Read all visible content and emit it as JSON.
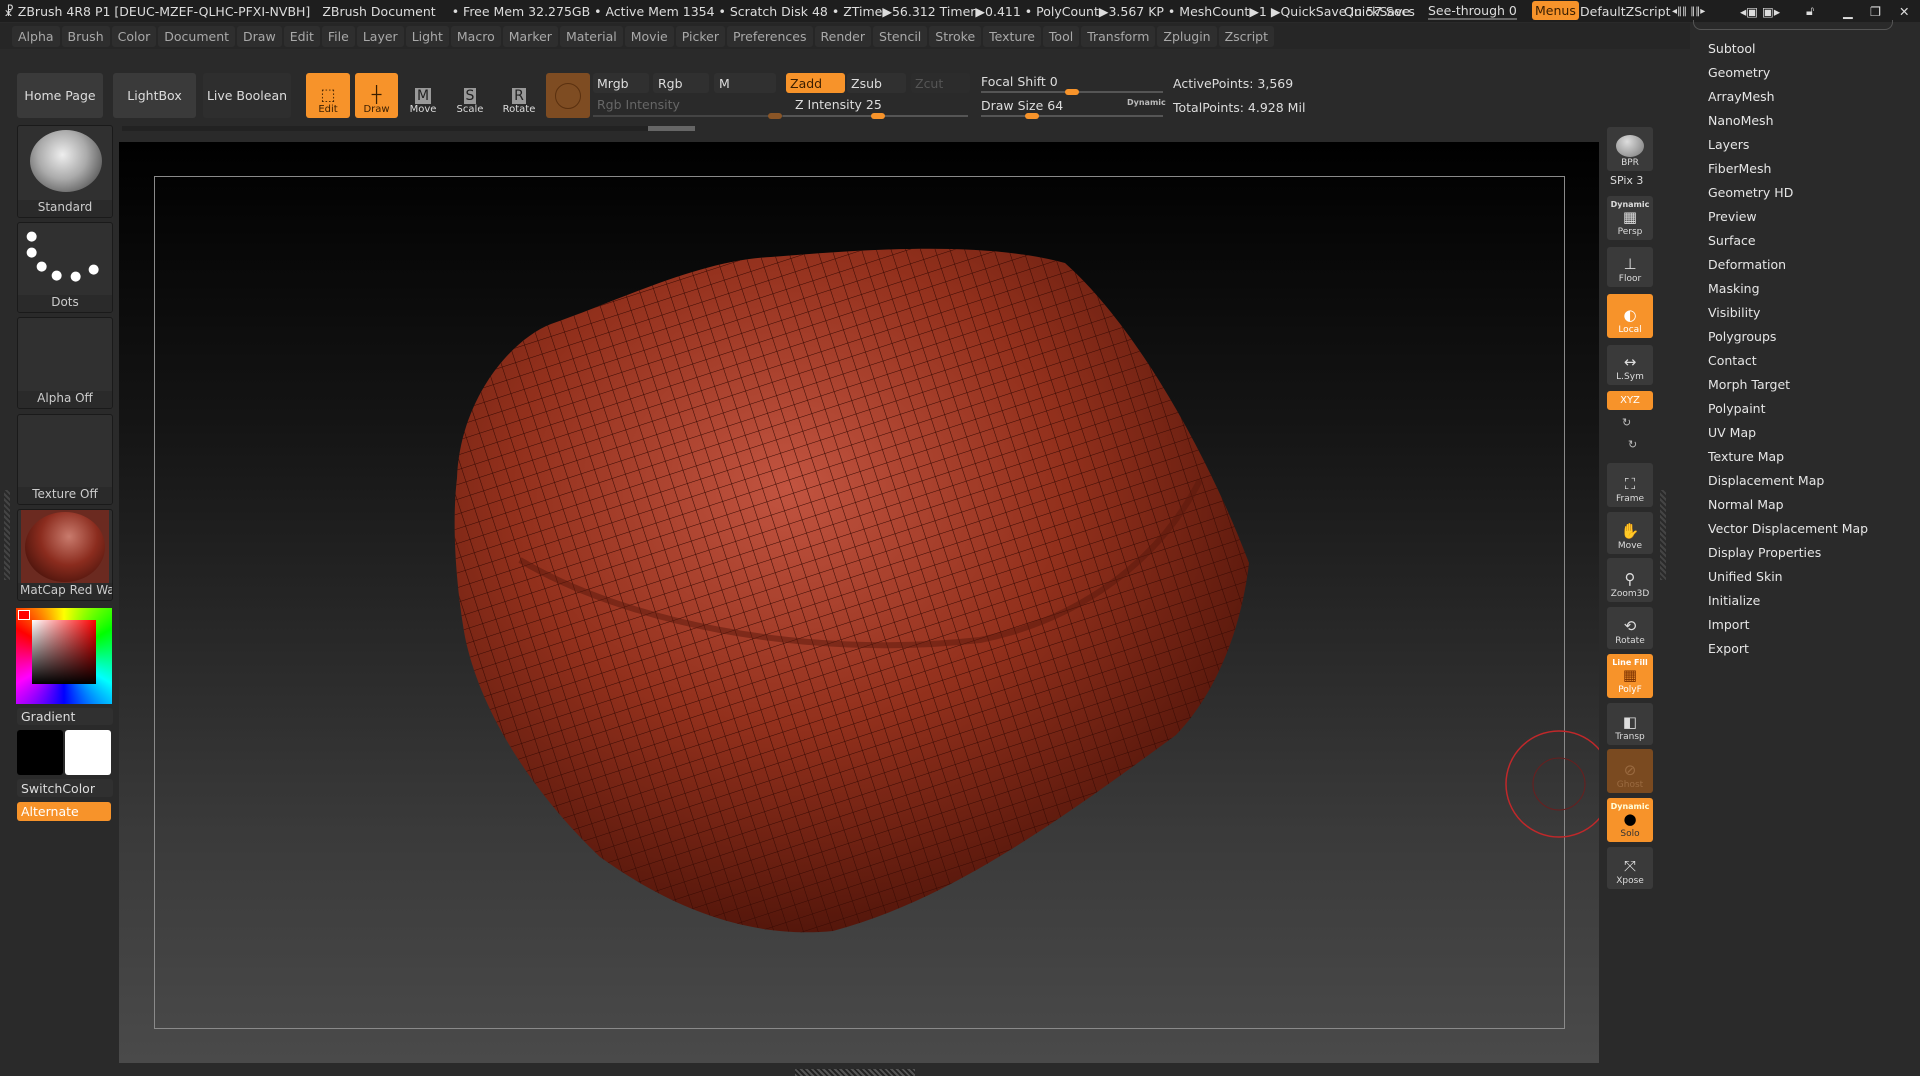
{
  "titlebar": {
    "app": "ZBrush 4R8 P1 [DEUC-MZEF-QLHC-PFXI-NVBH]",
    "document": "ZBrush Document",
    "stats": "• Free Mem 32.275GB • Active Mem 1354 • Scratch Disk 48 • ZTime▶56.312 Timer▶0.411 • PolyCount▶3.567 KP • MeshCount▶1 ▶QuickSave In 57 Secs",
    "quicksave": "QuickSave",
    "see_through": "See-through  0",
    "see_through_value": 0,
    "menus": "Menus",
    "default_zscript": "DefaultZScript"
  },
  "menubar": [
    "Alpha",
    "Brush",
    "Color",
    "Document",
    "Draw",
    "Edit",
    "File",
    "Layer",
    "Light",
    "Macro",
    "Marker",
    "Material",
    "Movie",
    "Picker",
    "Preferences",
    "Render",
    "Stencil",
    "Stroke",
    "Texture",
    "Tool",
    "Transform",
    "Zplugin",
    "Zscript"
  ],
  "toolbar": {
    "home": "Home Page",
    "lightbox": "LightBox",
    "live_boolean": "Live Boolean",
    "edit": "Edit",
    "draw": "Draw",
    "move": "Move",
    "scale": "Scale",
    "rotate": "Rotate",
    "mrgb": "Mrgb",
    "rgb": "Rgb",
    "m": "M",
    "rgb_intensity": "Rgb Intensity",
    "zadd": "Zadd",
    "zsub": "Zsub",
    "zcut": "Zcut",
    "z_intensity": "Z Intensity 25",
    "z_intensity_value": 25,
    "focal_shift": "Focal Shift 0",
    "focal_shift_value": 0,
    "draw_size": "Draw Size 64",
    "draw_size_value": 64,
    "dynamic": "Dynamic",
    "active_points": "ActivePoints: 3,569",
    "total_points": "TotalPoints: 4.928 Mil"
  },
  "left_shelf": {
    "brush": "Standard",
    "stroke": "Dots",
    "alpha": "Alpha Off",
    "texture": "Texture Off",
    "material": "MatCap Red Wax",
    "gradient": "Gradient",
    "switch_color": "SwitchColor",
    "alternate": "Alternate",
    "main_color": "#ff0000"
  },
  "right_shelf": {
    "bpr": "BPR",
    "spix": "SPix 3",
    "persp": "Persp",
    "persp_dyn": "Dynamic",
    "floor": "Floor",
    "local": "Local",
    "lsym": "L.Sym",
    "xyz": "XYZ",
    "frame": "Frame",
    "move": "Move",
    "zoom3d": "Zoom3D",
    "rotate": "Rotate",
    "polyf": "PolyF",
    "linefill": "Line Fill",
    "transp": "Transp",
    "ghost": "Ghost",
    "solo": "Solo",
    "solo_dyn": "Dynamic",
    "xpose": "Xpose"
  },
  "tray": [
    "Subtool",
    "Geometry",
    "ArrayMesh",
    "NanoMesh",
    "Layers",
    "FiberMesh",
    "Geometry HD",
    "Preview",
    "Surface",
    "Deformation",
    "Masking",
    "Visibility",
    "Polygroups",
    "Contact",
    "Morph Target",
    "Polypaint",
    "UV Map",
    "Texture Map",
    "Displacement Map",
    "Normal Map",
    "Vector Displacement Map",
    "Display Properties",
    "Unified Skin",
    "Initialize",
    "Import",
    "Export"
  ],
  "colors": {
    "accent": "#f7932a",
    "mesh": "#8e2a18"
  }
}
